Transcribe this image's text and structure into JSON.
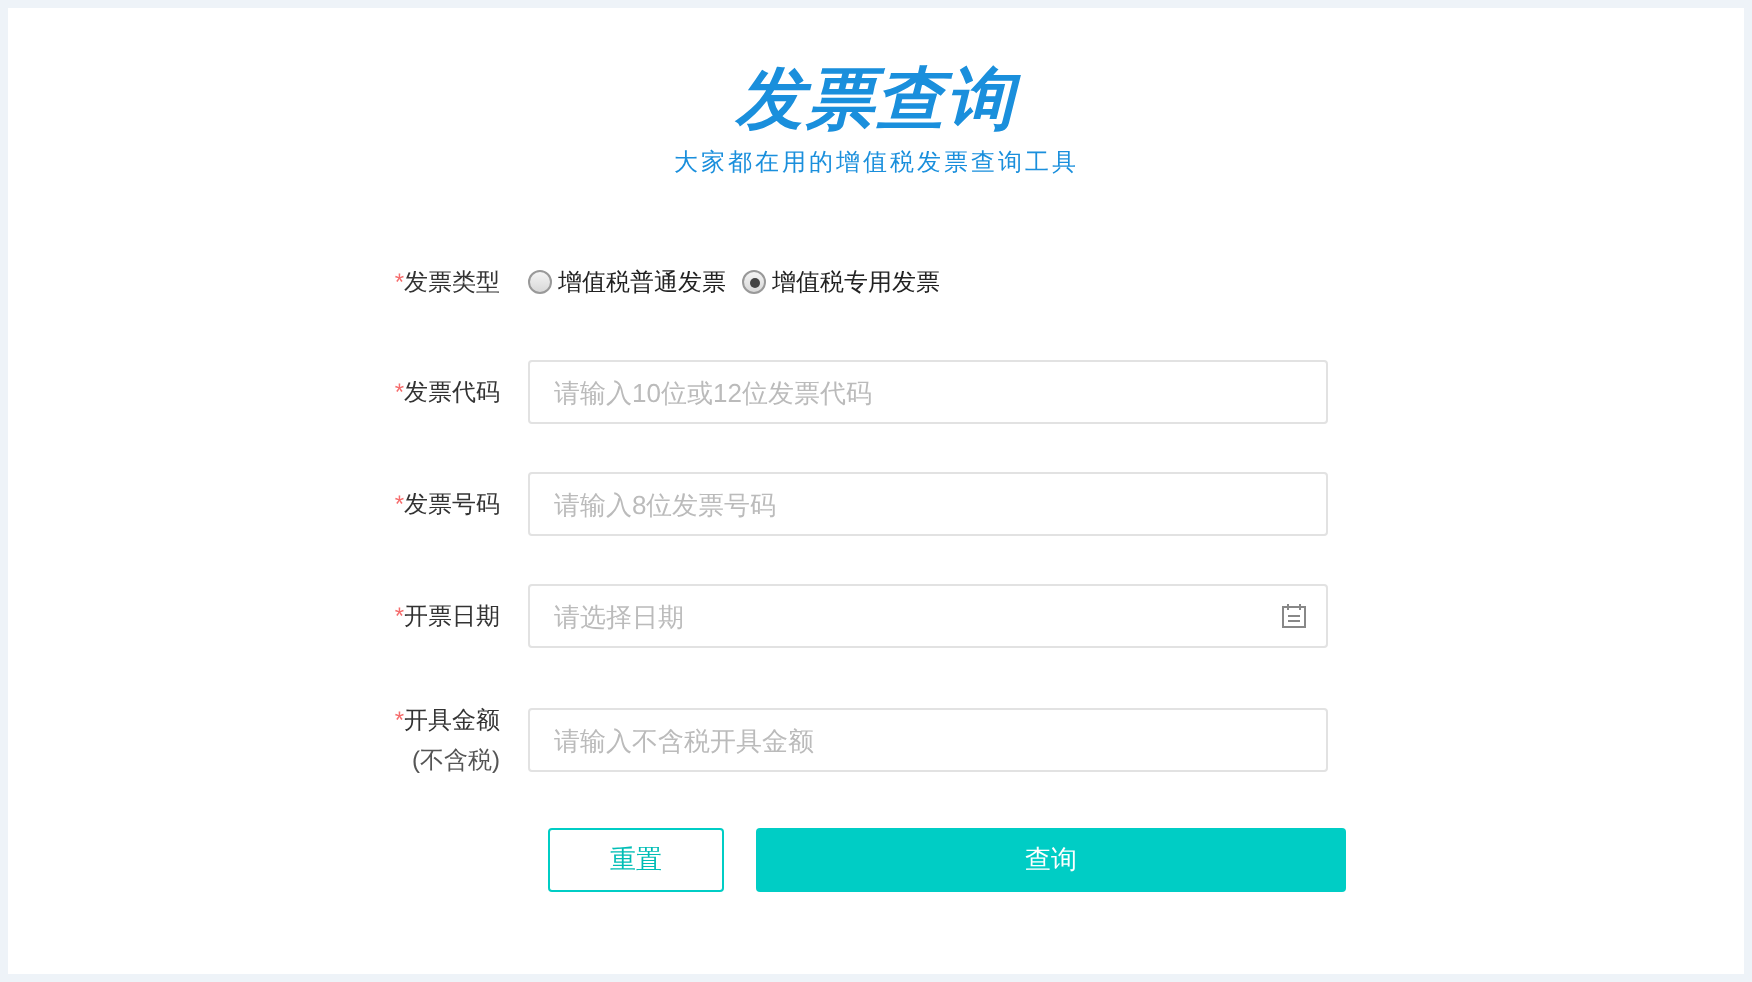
{
  "header": {
    "title": "发票查询",
    "subtitle": "大家都在用的增值税发票查询工具"
  },
  "form": {
    "rows": [
      {
        "kind": "radio",
        "required_mark": "*",
        "label": "发票类型",
        "options": [
          {
            "label": "增值税普通发票",
            "selected": false
          },
          {
            "label": "增值税专用发票",
            "selected": true
          }
        ]
      },
      {
        "kind": "text",
        "required_mark": "*",
        "label": "发票代码",
        "placeholder": "请输入10位或12位发票代码"
      },
      {
        "kind": "text",
        "required_mark": "*",
        "label": "发票号码",
        "placeholder": "请输入8位发票号码"
      },
      {
        "kind": "date",
        "required_mark": "*",
        "label": "开票日期",
        "placeholder": "请选择日期"
      },
      {
        "kind": "text",
        "required_mark": "*",
        "label": "开具金额",
        "sublabel": "(不含税)",
        "placeholder": "请输入不含税开具金额"
      }
    ]
  },
  "buttons": {
    "reset": "重置",
    "query": "查询"
  }
}
